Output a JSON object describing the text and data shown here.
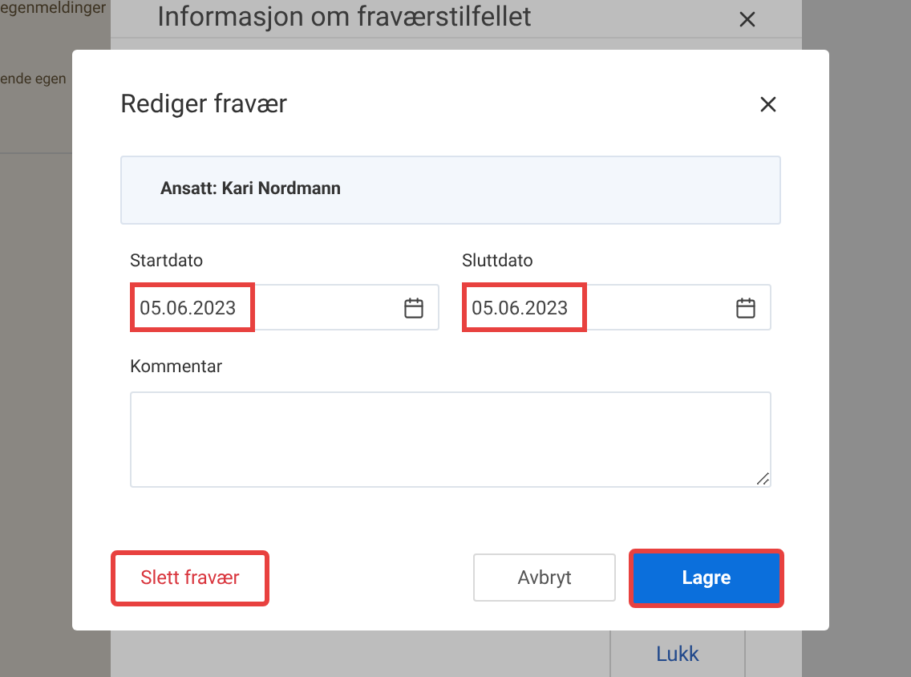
{
  "background": {
    "texts": [
      "egenmeldinger",
      "ende egen"
    ]
  },
  "back_dialog": {
    "title": "Informasjon om fraværstilfellet",
    "link": "Lukk"
  },
  "dialog": {
    "title": "Rediger fravær",
    "employee": "Ansatt: Kari Nordmann",
    "fields": [
      {
        "label": "Startdato",
        "value": "05.06.2023",
        "highlighted": true
      },
      {
        "label": "Sluttdato",
        "value": "05.06.2023",
        "highlighted": true
      }
    ],
    "comment": {
      "label": "Kommentar"
    },
    "buttons": [
      {
        "label": "Slett fravær",
        "kind": "danger",
        "highlighted": true
      },
      {
        "label": "Avbryt",
        "kind": "secondary",
        "highlighted": false
      },
      {
        "label": "Lagre",
        "kind": "primary",
        "highlighted": true
      }
    ]
  }
}
